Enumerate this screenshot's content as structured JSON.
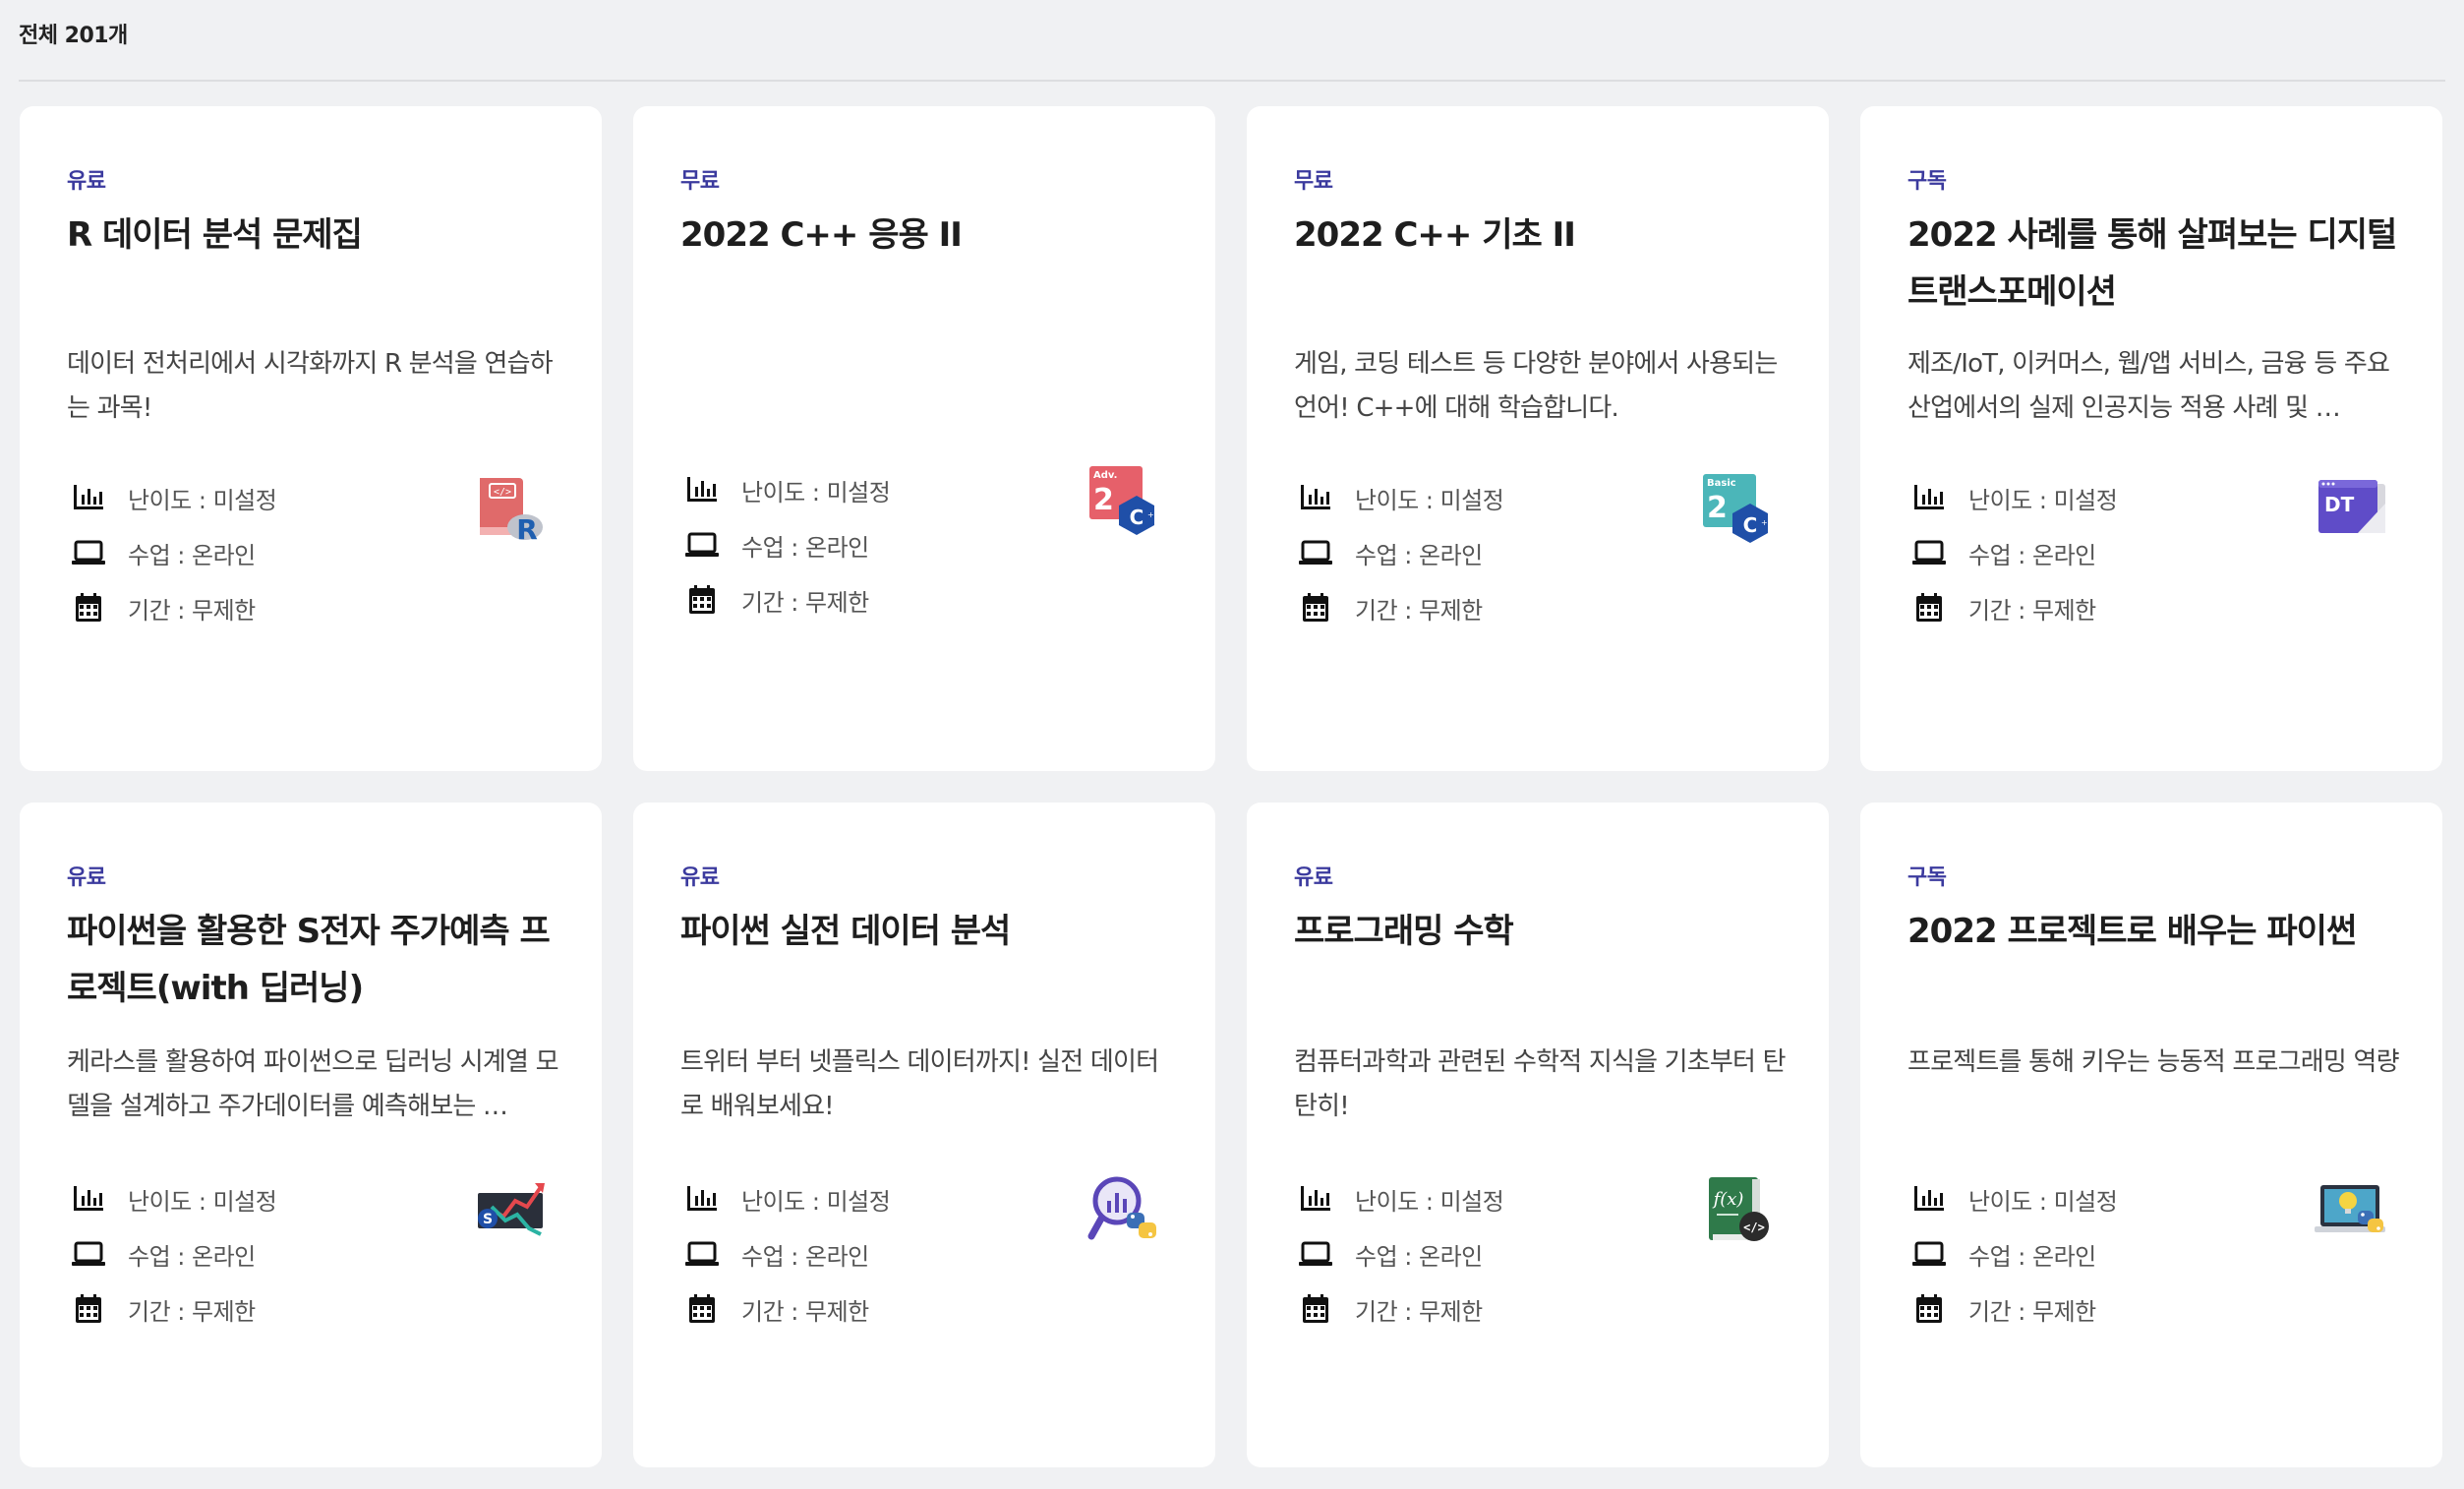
{
  "total_label": "전체 201개",
  "meta": {
    "difficulty": "난이도 : 미설정",
    "class": "수업 : 온라인",
    "period": "기간 : 무제한"
  },
  "accent_color": "#3b3a9e",
  "cards": [
    {
      "tag": "유료",
      "title": "R 데이터 분석 문제집",
      "desc": "데이터 전처리에서 시각화까지 R 분석을 연습하는 과목!",
      "thumb_icon": "r-book-icon"
    },
    {
      "tag": "무료",
      "title": "2022 C++ 응용 II",
      "desc": "",
      "thumb_icon": "cpp-adv-icon"
    },
    {
      "tag": "무료",
      "title": "2022 C++ 기초 II",
      "desc": "게임, 코딩 테스트 등 다양한 분야에서 사용되는 언어! C++에 대해 학습합니다.",
      "thumb_icon": "cpp-basic-icon"
    },
    {
      "tag": "구독",
      "title": "2022 사례를 통해 살펴보는 디지털 트랜스포메이션",
      "desc": "제조/IoT, 이커머스, 웹/앱 서비스, 금융 등 주요 산업에서의 실제 인공지능 적용 사례 및 …",
      "thumb_icon": "dt-window-icon"
    },
    {
      "tag": "유료",
      "title": "파이썬을 활용한 S전자 주가예측 프로젝트(with 딥러닝)",
      "desc": "케라스를 활용하여 파이썬으로 딥러닝 시계열 모델을 설계하고 주가데이터를 예측해보는 …",
      "thumb_icon": "stock-chart-icon"
    },
    {
      "tag": "유료",
      "title": "파이썬 실전 데이터 분석",
      "desc": "트위터 부터 넷플릭스 데이터까지! 실전 데이터로 배워보세요!",
      "thumb_icon": "python-magnifier-icon"
    },
    {
      "tag": "유료",
      "title": "프로그래밍 수학",
      "desc": "컴퓨터과학과 관련된 수학적 지식을 기초부터 탄탄히!",
      "thumb_icon": "math-book-icon"
    },
    {
      "tag": "구독",
      "title": "2022 프로젝트로 배우는 파이썬",
      "desc": "프로젝트를 통해 키우는 능동적 프로그래밍 역량",
      "thumb_icon": "python-laptop-icon"
    }
  ]
}
